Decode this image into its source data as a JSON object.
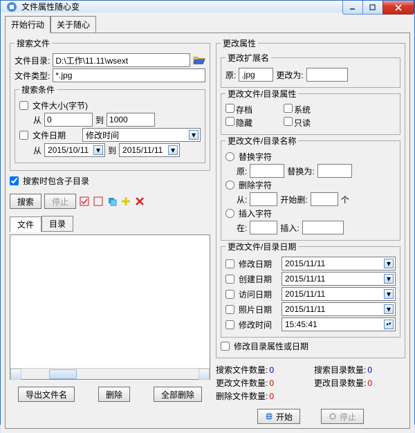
{
  "window": {
    "title": "文件属性随心变"
  },
  "tabs": {
    "t1": "开始行动",
    "t2": "关于随心"
  },
  "search": {
    "legend": "搜索文件",
    "dir_label": "文件目录:",
    "dir_value": "D:\\工作\\11.11\\wsext",
    "type_label": "文件类型:",
    "type_value": "*.jpg",
    "cond_legend": "搜索条件",
    "size_cb": "文件大小(字节)",
    "from": "从",
    "to": "到",
    "size_from": "0",
    "size_to": "1000",
    "date_cb": "文件日期",
    "date_kind": "修改时间",
    "date_from": "2015/10/11",
    "date_to": "2015/11/11",
    "subdir_cb": "搜索时包含子目录",
    "btn_search": "搜索",
    "btn_stop": "停止",
    "subtab_file": "文件",
    "subtab_dir": "目录",
    "btn_export": "导出文件名",
    "btn_delete": "删除",
    "btn_delete_all": "全部删除"
  },
  "attr": {
    "legend": "更改属性",
    "ext_legend": "更改扩展名",
    "orig_label": "原:",
    "orig_value": ".jpg",
    "to_label": "更改为:",
    "fileattr_legend": "更改文件/目录属性",
    "archive": "存档",
    "system": "系统",
    "hidden": "隐藏",
    "readonly": "只读",
    "name_legend": "更改文件/目录名称",
    "replace_rb": "替换字符",
    "orig2": "原:",
    "replace_to": "替换为:",
    "delete_rb": "删除字符",
    "from2": "从:",
    "start_del": "开始删:",
    "count_unit": "个",
    "insert_rb": "插入字符",
    "at": "在:",
    "insert": "插入:",
    "date_legend": "更改文件/目录日期",
    "mod_date": "修改日期",
    "create_date": "创建日期",
    "access_date": "访问日期",
    "photo_date": "照片日期",
    "mod_time": "修改时间",
    "d1": "2015/11/11",
    "d2": "2015/11/11",
    "d3": "2015/11/11",
    "d4": "2015/11/11",
    "t1": "15:45:41",
    "dir_attr_cb": "修改目录属性或日期"
  },
  "stats": {
    "sfile": "搜索文件数量:",
    "sdir": "搜索目录数量:",
    "cfile": "更改文件数量:",
    "cdir": "更改目录数量:",
    "dfile": "删除文件数量:",
    "v0": "0"
  },
  "final": {
    "start": "开始",
    "stop": "停止"
  }
}
